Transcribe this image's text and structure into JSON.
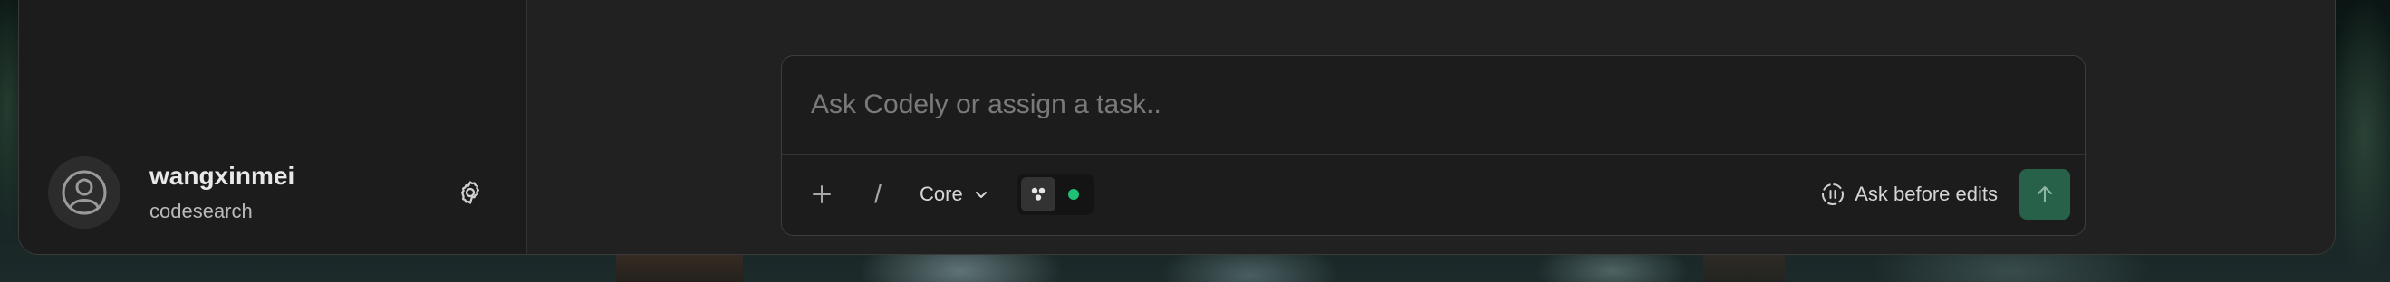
{
  "user": {
    "name": "wangxinmei",
    "organization": "codesearch"
  },
  "composer": {
    "placeholder": "Ask Codely or assign a task..",
    "slash_label": "/",
    "mode_label": "Core",
    "ask_before_edits_label": "Ask before edits"
  },
  "icons": {
    "avatar": "user-avatar-icon",
    "settings": "gear-icon",
    "plus": "plus-icon",
    "chevron": "chevron-down-icon",
    "agent": "agent-icon",
    "ask_mode": "pause-circle-icon",
    "send": "arrow-up-icon"
  },
  "colors": {
    "window_bg": "#212121",
    "sidebar_bg": "#1c1c1c",
    "status_dot": "#1fbf76",
    "send_button_bg": "#27614a",
    "send_arrow": "#8fb7a6"
  }
}
